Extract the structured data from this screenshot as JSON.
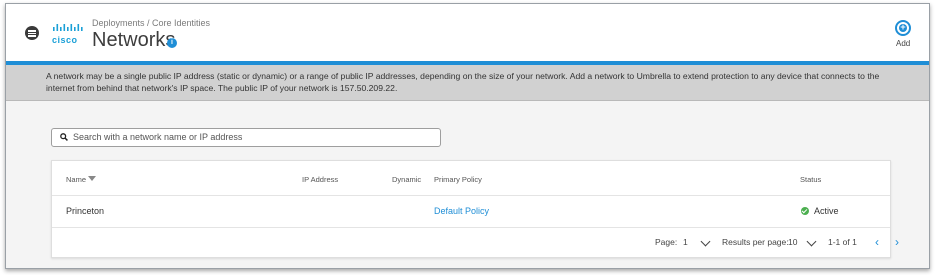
{
  "header": {
    "logo_text": "cisco",
    "breadcrumb": "Deployments / Core Identities",
    "title": "Networks",
    "info_glyph": "i",
    "add_glyph": "+",
    "add_label": "Add",
    "accent_color": "#1f8ed6"
  },
  "notice": {
    "text": "A network may be a single public IP address (static or dynamic) or a range of public IP addresses, depending on the size of your network. Add a network to Umbrella to extend protection to any device that connects to the internet from behind that network's IP space. The public IP of your network is 157.50.209.22."
  },
  "search": {
    "placeholder": "Search with a network name or IP address"
  },
  "table": {
    "columns": {
      "name": "Name",
      "ip": "IP Address",
      "dynamic": "Dynamic",
      "policy": "Primary Policy",
      "status": "Status"
    },
    "rows": [
      {
        "name": "Princeton",
        "ip": "",
        "dynamic": "",
        "policy": "Default Policy",
        "status": "Active"
      }
    ]
  },
  "pagination": {
    "page_label": "Page:",
    "page_value": "1",
    "per_page_label": "Results per page:",
    "per_page_value": "10",
    "range": "1-1 of 1",
    "prev_glyph": "‹",
    "next_glyph": "›"
  }
}
